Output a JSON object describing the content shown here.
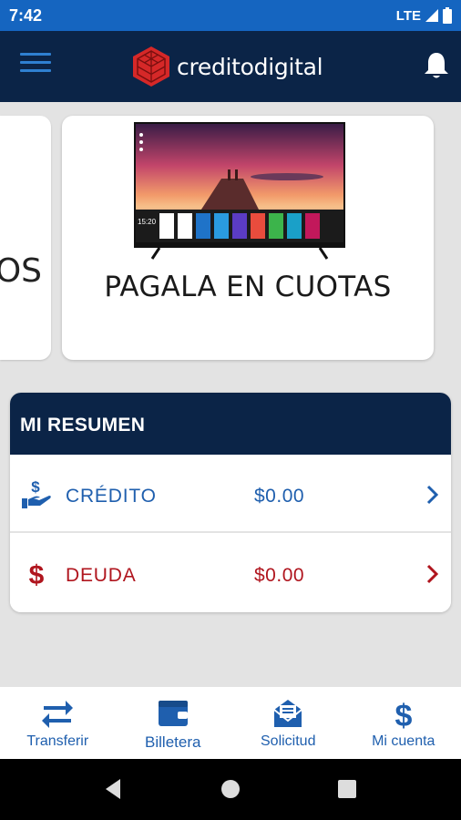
{
  "status": {
    "time": "7:42",
    "network": "LTE"
  },
  "app": {
    "logo_text": "creditodigital"
  },
  "carousel": {
    "prev_card_text": "OS",
    "main_card_text": "PAGALA EN CUOTAS",
    "tv_clock": "15:20"
  },
  "summary": {
    "title": "MI RESUMEN",
    "rows": [
      {
        "label": "CRÉDITO",
        "value": "$0.00"
      },
      {
        "label": "DEUDA",
        "value": "$0.00"
      }
    ]
  },
  "bottom_nav": [
    {
      "label": "Transferir",
      "icon": "transfer-arrows-icon"
    },
    {
      "label": "Billetera",
      "icon": "wallet-icon"
    },
    {
      "label": "Solicitud",
      "icon": "envelope-form-icon"
    },
    {
      "label": "Mi cuenta",
      "icon": "dollar-icon"
    }
  ],
  "colors": {
    "status_bar": "#1565c0",
    "header": "#0b2447",
    "credit": "#1f5fae",
    "debt": "#b0151e",
    "background": "#e3e3e3"
  }
}
